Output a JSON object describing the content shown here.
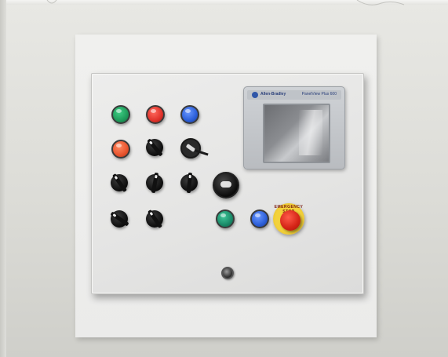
{
  "scene": {
    "subject": "Industrial control panel"
  },
  "hmi": {
    "brand": "Allen-Bradley",
    "model": "PanelView Plus 600"
  },
  "estop": {
    "collar_text": "EMERGENCY STOP"
  },
  "colors": {
    "green_light": "#1f9a5a",
    "red_light": "#e0322b",
    "blue_light": "#2b5ed8",
    "orange_light": "#e8542e",
    "estop_red": "#d32315",
    "estop_yellow": "#f3d23b",
    "panel_gray": "#e6e6e5"
  },
  "icons": [
    "pilot-light",
    "rotary-selector",
    "key-switch",
    "emergency-stop",
    "indicator-lamp"
  ]
}
